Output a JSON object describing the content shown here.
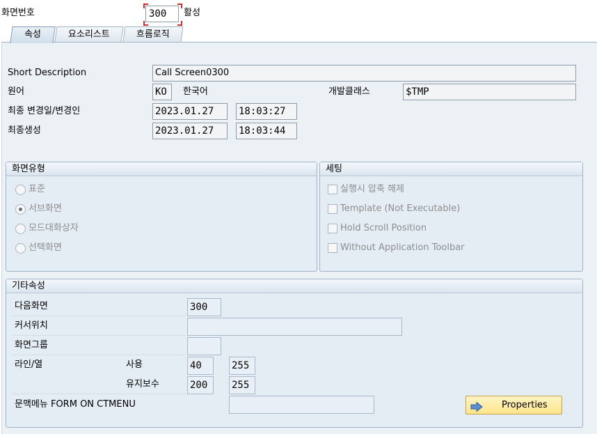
{
  "header": {
    "screen_number_label": "화면번호",
    "screen_number_value": "300",
    "status": "활성"
  },
  "tabs": [
    {
      "label": "속성"
    },
    {
      "label": "요소리스트"
    },
    {
      "label": "흐름로직"
    }
  ],
  "attributes": {
    "short_description_label": "Short Description",
    "short_description_value": "Call Screen0300",
    "language_label": "원어",
    "language_code": "KO",
    "language_name": "한국어",
    "dev_class_label": "개발클래스",
    "dev_class_value": "$TMP",
    "last_changed_label": "최종 변경일/변경인",
    "last_changed_date": "2023.01.27",
    "last_changed_time": "18:03:27",
    "last_generated_label": "최종생성",
    "last_generated_date": "2023.01.27",
    "last_generated_time": "18:03:44"
  },
  "screen_type": {
    "title": "화면유형",
    "options": [
      {
        "label": "표준",
        "selected": false
      },
      {
        "label": "서브화면",
        "selected": true
      },
      {
        "label": "모드대화상자",
        "selected": false
      },
      {
        "label": "선택화면",
        "selected": false
      }
    ]
  },
  "settings": {
    "title": "세팅",
    "options": [
      {
        "label": "실행시 압축 해제",
        "checked": false
      },
      {
        "label": "Template (Not Executable)",
        "checked": false
      },
      {
        "label": "Hold Scroll Position",
        "checked": false
      },
      {
        "label": "Without Application Toolbar",
        "checked": false
      }
    ]
  },
  "other": {
    "title": "기타속성",
    "next_screen_label": "다음화면",
    "next_screen_value": "300",
    "cursor_pos_label": "커서위치",
    "cursor_pos_value": "",
    "screen_group_label": "화면그룹",
    "screen_group_value": "",
    "lines_cols_label": "라인/열",
    "used_label": "사용",
    "used_lines": "40",
    "used_cols": "255",
    "maint_label": "유지보수",
    "maint_lines": "200",
    "maint_cols": "255",
    "context_menu_label": "문맥메뉴 FORM ON CTMENU",
    "context_menu_value": "",
    "properties_button": "Properties"
  },
  "colors": {
    "panel_bg": "#ecf1f6",
    "group_bg": "#e4ecf4",
    "button_bg": "#fde58a",
    "focus_corner": "#d12c2c"
  }
}
